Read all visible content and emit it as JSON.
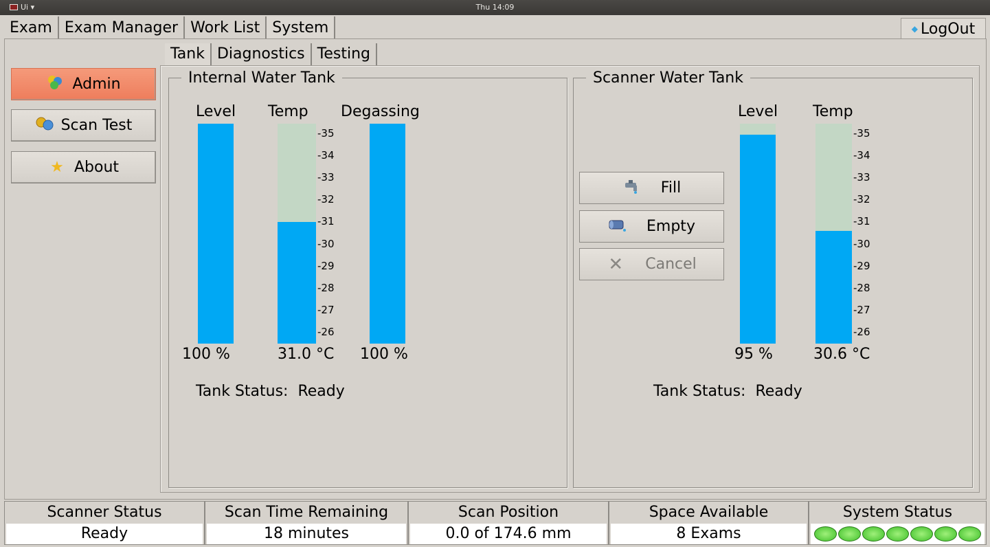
{
  "topbar": {
    "app_label": "Ui ▾",
    "clock": "Thu 14:09"
  },
  "main_tabs": [
    {
      "label": "Exam"
    },
    {
      "label": "Exam Manager"
    },
    {
      "label": "Work List"
    },
    {
      "label": "System"
    }
  ],
  "logout_label": "LogOut",
  "side_buttons": [
    {
      "label": "Admin",
      "icon": "admin-icon"
    },
    {
      "label": "Scan Test",
      "icon": "gears-icon"
    },
    {
      "label": "About",
      "icon": "star-icon"
    }
  ],
  "sub_tabs": [
    {
      "label": "Tank"
    },
    {
      "label": "Diagnostics"
    },
    {
      "label": "Testing"
    }
  ],
  "internal_tank": {
    "title": "Internal Water Tank",
    "level_label": "Level",
    "temp_label": "Temp",
    "degas_label": "Degassing",
    "level_fraction": 1.0,
    "degas_fraction": 1.0,
    "temp_value": 31.0,
    "level_text": "100 %",
    "temp_text": "31.0 °C",
    "degas_text": "100 %",
    "status": "Tank Status:  Ready"
  },
  "scanner_tank": {
    "title": "Scanner Water Tank",
    "level_label": "Level",
    "temp_label": "Temp",
    "level_fraction": 0.95,
    "temp_value": 30.6,
    "level_text": "95 %",
    "temp_text": "30.6 °C",
    "status": "Tank Status:  Ready"
  },
  "temp_scale": {
    "min": 26,
    "max": 35,
    "ticks": [
      "-35",
      "-34",
      "-33",
      "-32",
      "-31",
      "-30",
      "-29",
      "-28",
      "-27",
      "-26"
    ]
  },
  "action_buttons": {
    "fill": "Fill",
    "empty": "Empty",
    "cancel": "Cancel"
  },
  "status_bar": {
    "scanner_status_header": "Scanner Status",
    "scanner_status_value": "Ready",
    "scan_time_header": "Scan Time Remaining",
    "scan_time_value": "18 minutes",
    "scan_position_header": "Scan Position",
    "scan_position_value": "0.0 of 174.6 mm",
    "space_header": "Space Available",
    "space_value": "8 Exams",
    "system_status_header": "System Status",
    "system_status_leds": 7
  },
  "colors": {
    "fill": "#00a8f4",
    "track": "#c3d7c5",
    "active_button": "#f08a66",
    "led": "#5fd43a"
  }
}
